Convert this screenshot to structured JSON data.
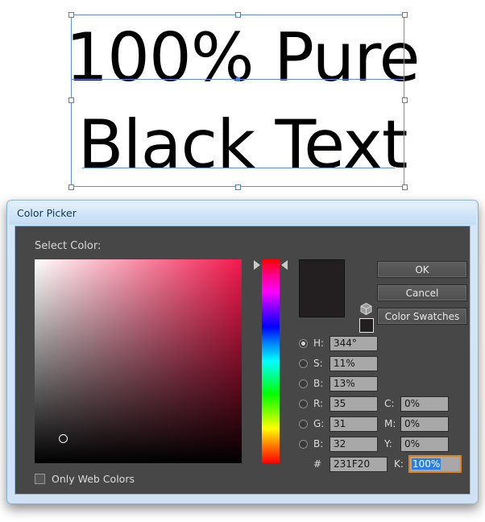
{
  "artwork": {
    "line1": "100% Pure",
    "line2": "Black Text",
    "selection_handles": 8
  },
  "dialog": {
    "title": "Color Picker",
    "section_label": "Select Color:",
    "buttons": {
      "ok": "OK",
      "cancel": "Cancel",
      "color_swatches": "Color Swatches"
    },
    "preview_color": "#231F20",
    "checkbox": {
      "label": "Only Web Colors",
      "checked": false
    },
    "values": {
      "h_label": "H:",
      "h_value": "344°",
      "s_label": "S:",
      "s_value": "11%",
      "b_label": "B:",
      "b_value": "13%",
      "r_label": "R:",
      "r_value": "35",
      "g_label": "G:",
      "g_value": "31",
      "b2_label": "B:",
      "b2_value": "32",
      "hex_sign": "#",
      "hex_value": "231F20",
      "c_label": "C:",
      "c_value": "0%",
      "m_label": "M:",
      "m_value": "0%",
      "y_label": "Y:",
      "y_value": "0%",
      "k_label": "K:",
      "k_value": "100%",
      "selected_radio": "H"
    }
  }
}
